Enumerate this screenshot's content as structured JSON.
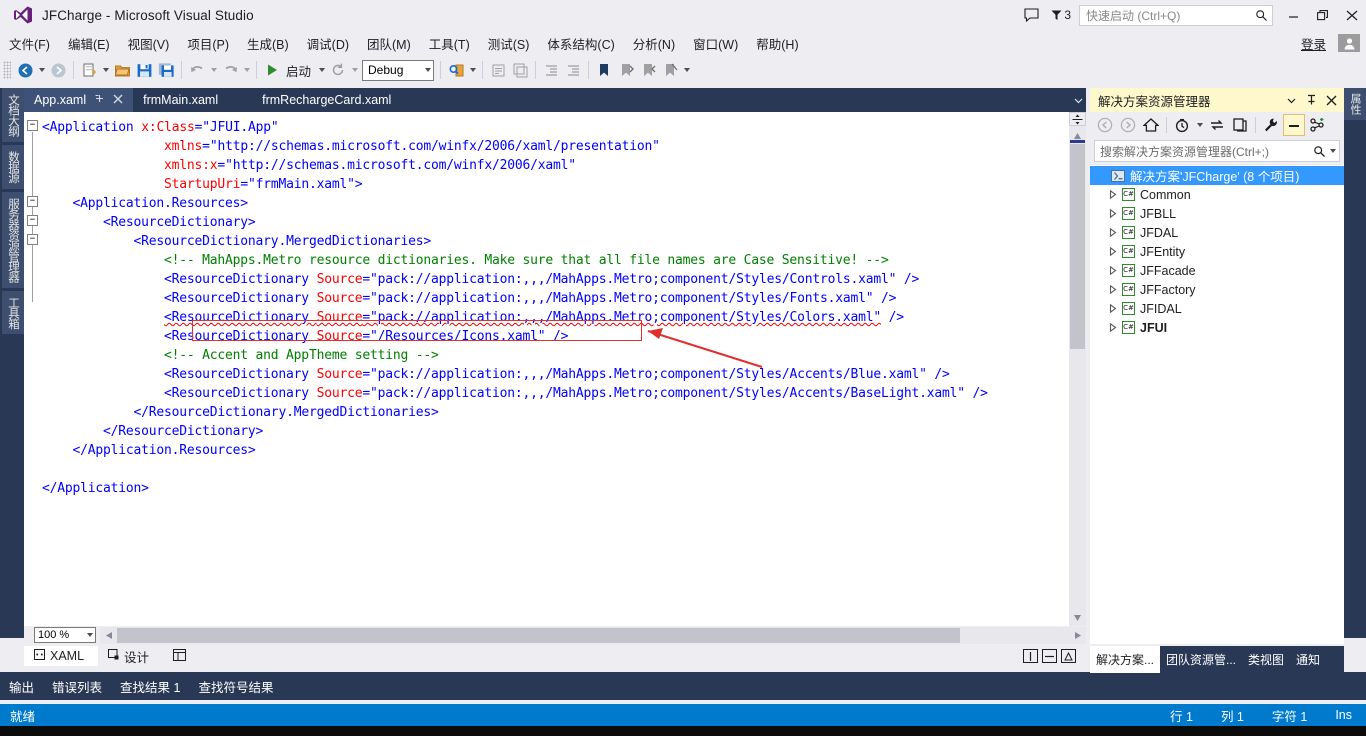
{
  "window": {
    "title": "JFCharge - Microsoft Visual Studio",
    "logo_icon": "visual-studio-logo",
    "feedback_icon": "feedback-smiley-icon",
    "notification_icon": "notification-flag-icon",
    "notification_count": "3",
    "minimize_icon": "minimize-icon",
    "restore_icon": "restore-icon",
    "close_icon": "close-icon"
  },
  "quick_launch": {
    "placeholder": "快速启动 (Ctrl+Q)",
    "value": "",
    "search_icon": "search-icon"
  },
  "menubar": {
    "items": [
      {
        "label": "文件(F)"
      },
      {
        "label": "编辑(E)"
      },
      {
        "label": "视图(V)"
      },
      {
        "label": "项目(P)"
      },
      {
        "label": "生成(B)"
      },
      {
        "label": "调试(D)"
      },
      {
        "label": "团队(M)"
      },
      {
        "label": "工具(T)"
      },
      {
        "label": "测试(S)"
      },
      {
        "label": "体系结构(C)"
      },
      {
        "label": "分析(N)"
      },
      {
        "label": "窗口(W)"
      },
      {
        "label": "帮助(H)"
      }
    ],
    "signin_label": "登录",
    "avatar_icon": "user-avatar-icon"
  },
  "toolbar": {
    "navigate_back_icon": "navigate-back-icon",
    "navigate_forward_icon": "navigate-forward-icon",
    "new_project_icon": "new-project-icon",
    "open_file_icon": "open-file-icon",
    "save_icon": "save-icon",
    "save_all_icon": "save-all-icon",
    "undo_icon": "undo-icon",
    "redo_icon": "redo-icon",
    "start_icon": "start-debug-icon",
    "start_label": "启动",
    "restart_icon": "restart-icon",
    "config_value": "Debug",
    "find_icon": "find-in-files-icon",
    "comment_icon": "comment-selection-icon",
    "uncomment_icon": "uncomment-selection-icon",
    "outdent_icon": "outdent-icon",
    "indent_icon": "indent-icon",
    "bookmark_icon": "bookmark-icon",
    "prev_bookmark_icon": "previous-bookmark-icon",
    "next_bookmark_icon": "next-bookmark-icon",
    "clear_bookmarks_icon": "clear-bookmarks-icon",
    "overflow_icon": "toolbar-overflow-icon"
  },
  "left_vertical_tabs": [
    {
      "label": "文档大纲"
    },
    {
      "label": "数据源"
    },
    {
      "label": "服务器资源管理器"
    },
    {
      "label": "工具箱"
    }
  ],
  "right_vertical_tabs": [
    {
      "label": "属性"
    }
  ],
  "editor_tabs": {
    "items": [
      {
        "label": "App.xaml",
        "active": true,
        "pin_icon": "pin-icon",
        "close_icon": "close-tab-icon"
      },
      {
        "label": "frmMain.xaml",
        "active": false
      },
      {
        "label": "frmRechargeCard.xaml",
        "active": false
      }
    ],
    "dropdown_icon": "tab-list-dropdown-icon"
  },
  "code": {
    "lines": [
      {
        "indent": 0,
        "fold": "minus",
        "segments": [
          {
            "t": "<",
            "c": "k-el"
          },
          {
            "t": "Application",
            "c": "k-el"
          },
          {
            "t": " ",
            "c": ""
          },
          {
            "t": "x:Class",
            "c": "k-attr"
          },
          {
            "t": "=",
            "c": "k-pun"
          },
          {
            "t": "\"JFUI.App\"",
            "c": "k-val"
          }
        ]
      },
      {
        "indent": 0,
        "segments": [
          {
            "t": "                ",
            "c": ""
          },
          {
            "t": "xmlns",
            "c": "k-attr"
          },
          {
            "t": "=",
            "c": "k-pun"
          },
          {
            "t": "\"http://schemas.microsoft.com/winfx/2006/xaml/presentation\"",
            "c": "k-val"
          }
        ]
      },
      {
        "indent": 0,
        "segments": [
          {
            "t": "                ",
            "c": ""
          },
          {
            "t": "xmlns:x",
            "c": "k-attr"
          },
          {
            "t": "=",
            "c": "k-pun"
          },
          {
            "t": "\"http://schemas.microsoft.com/winfx/2006/xaml\"",
            "c": "k-val"
          }
        ]
      },
      {
        "indent": 0,
        "segments": [
          {
            "t": "                ",
            "c": ""
          },
          {
            "t": "StartupUri",
            "c": "k-attr"
          },
          {
            "t": "=",
            "c": "k-pun"
          },
          {
            "t": "\"frmMain.xaml\">",
            "c": "k-val"
          }
        ]
      },
      {
        "indent": 0,
        "fold": "minus",
        "segments": [
          {
            "t": "    ",
            "c": ""
          },
          {
            "t": "<Application.Resources>",
            "c": "k-el"
          }
        ]
      },
      {
        "indent": 0,
        "fold": "minus",
        "segments": [
          {
            "t": "        ",
            "c": ""
          },
          {
            "t": "<ResourceDictionary>",
            "c": "k-el"
          }
        ]
      },
      {
        "indent": 0,
        "fold": "minus",
        "segments": [
          {
            "t": "            ",
            "c": ""
          },
          {
            "t": "<ResourceDictionary.MergedDictionaries>",
            "c": "k-el"
          }
        ]
      },
      {
        "indent": 0,
        "segments": [
          {
            "t": "                ",
            "c": ""
          },
          {
            "t": "<!-- MahApps.Metro resource dictionaries. Make sure that all file names are Case Sensitive! -->",
            "c": "k-cmt"
          }
        ]
      },
      {
        "indent": 0,
        "segments": [
          {
            "t": "                ",
            "c": ""
          },
          {
            "t": "<ResourceDictionary ",
            "c": "k-el"
          },
          {
            "t": "Source",
            "c": "k-attr"
          },
          {
            "t": "=",
            "c": "k-pun"
          },
          {
            "t": "\"pack://application:,,,/MahApps.Metro;component/Styles/Controls.xaml\"",
            "c": "k-val"
          },
          {
            "t": " />",
            "c": "k-el"
          }
        ]
      },
      {
        "indent": 0,
        "segments": [
          {
            "t": "                ",
            "c": ""
          },
          {
            "t": "<ResourceDictionary ",
            "c": "k-el"
          },
          {
            "t": "Source",
            "c": "k-attr"
          },
          {
            "t": "=",
            "c": "k-pun"
          },
          {
            "t": "\"pack://application:,,,/MahApps.Metro;component/Styles/Fonts.xaml\"",
            "c": "k-val"
          },
          {
            "t": " />",
            "c": "k-el"
          }
        ]
      },
      {
        "indent": 0,
        "segments": [
          {
            "t": "                ",
            "c": ""
          },
          {
            "t": "<ResourceDictionary ",
            "c": "k-el squig"
          },
          {
            "t": "Source",
            "c": "k-attr squig"
          },
          {
            "t": "=",
            "c": "k-pun squig"
          },
          {
            "t": "\"pack://application:,,,/MahApps.Metro;component/Styles/Colors.xaml\"",
            "c": "k-val squig"
          },
          {
            "t": " />",
            "c": "k-el"
          }
        ]
      },
      {
        "indent": 0,
        "segments": [
          {
            "t": "                ",
            "c": ""
          },
          {
            "t": "<ResourceDictionary ",
            "c": "k-el"
          },
          {
            "t": "Source",
            "c": "k-attr"
          },
          {
            "t": "=",
            "c": "k-pun"
          },
          {
            "t": "\"/Resources/Icons.xaml\"",
            "c": "k-val"
          },
          {
            "t": " />",
            "c": "k-el"
          }
        ]
      },
      {
        "indent": 0,
        "segments": [
          {
            "t": "                ",
            "c": ""
          },
          {
            "t": "<!-- Accent and AppTheme setting -->",
            "c": "k-cmt"
          }
        ]
      },
      {
        "indent": 0,
        "segments": [
          {
            "t": "                ",
            "c": ""
          },
          {
            "t": "<ResourceDictionary ",
            "c": "k-el"
          },
          {
            "t": "Source",
            "c": "k-attr"
          },
          {
            "t": "=",
            "c": "k-pun"
          },
          {
            "t": "\"pack://application:,,,/MahApps.Metro;component/Styles/Accents/Blue.xaml\"",
            "c": "k-val"
          },
          {
            "t": " />",
            "c": "k-el"
          }
        ]
      },
      {
        "indent": 0,
        "segments": [
          {
            "t": "                ",
            "c": ""
          },
          {
            "t": "<ResourceDictionary ",
            "c": "k-el"
          },
          {
            "t": "Source",
            "c": "k-attr"
          },
          {
            "t": "=",
            "c": "k-pun"
          },
          {
            "t": "\"pack://application:,,,/MahApps.Metro;component/Styles/Accents/BaseLight.xaml\"",
            "c": "k-val"
          },
          {
            "t": " />",
            "c": "k-el"
          }
        ]
      },
      {
        "indent": 0,
        "segments": [
          {
            "t": "            ",
            "c": ""
          },
          {
            "t": "</ResourceDictionary.MergedDictionaries>",
            "c": "k-el"
          }
        ]
      },
      {
        "indent": 0,
        "segments": [
          {
            "t": "        ",
            "c": ""
          },
          {
            "t": "</ResourceDictionary>",
            "c": "k-el"
          }
        ]
      },
      {
        "indent": 0,
        "segments": [
          {
            "t": "    ",
            "c": ""
          },
          {
            "t": "</Application.Resources>",
            "c": "k-el"
          }
        ]
      },
      {
        "indent": 0,
        "segments": [
          {
            "t": "",
            "c": ""
          }
        ]
      },
      {
        "indent": 0,
        "segments": [
          {
            "t": "</Application>",
            "c": "k-el"
          }
        ]
      }
    ],
    "annotation": {
      "highlight_target": "<ResourceDictionary Source=\"/Resources/Icons.xaml\" />",
      "arrow_color": "#E03030",
      "box_color": "#E03030"
    }
  },
  "editor_footer": {
    "zoom_level": "100 %",
    "scroll_left_icon": "scroll-left-icon",
    "scroll_right_icon": "scroll-right-icon"
  },
  "designer_tabs": {
    "items": [
      {
        "label": "XAML",
        "icon": "xaml-view-icon",
        "active": true
      },
      {
        "label": "设计",
        "icon": "design-view-icon",
        "active": false
      }
    ],
    "swap_panes_icon": "swap-panes-icon",
    "split_vertical_icon": "split-vertical-icon",
    "split_horizontal_icon": "split-horizontal-icon",
    "expand_pane_icon": "expand-pane-icon"
  },
  "dock_tabs": {
    "items": [
      {
        "label": "输出"
      },
      {
        "label": "错误列表"
      },
      {
        "label": "查找结果 1"
      },
      {
        "label": "查找符号结果"
      }
    ]
  },
  "solution_explorer": {
    "title": "解决方案资源管理器",
    "dropdown_icon": "chevron-down-icon",
    "pin_icon": "pin-icon",
    "close_icon": "close-icon",
    "toolbar": {
      "back_icon": "navigate-back-icon",
      "forward_icon": "navigate-forward-icon",
      "home_icon": "home-icon",
      "pending_changes_icon": "pending-changes-filter-icon",
      "sync_icon": "sync-with-active-document-icon",
      "refresh_icon": "refresh-icon",
      "properties_icon": "properties-wrench-icon",
      "collapse_all_icon": "collapse-all-icon",
      "show_all_files_icon": "show-all-files-icon"
    },
    "search": {
      "placeholder": "搜索解决方案资源管理器(Ctrl+;)",
      "value": "",
      "search_icon": "search-icon",
      "dropdown_icon": "chevron-down-icon"
    },
    "tree": [
      {
        "label": "解决方案'JFCharge' (8 个项目)",
        "icon": "solution-icon",
        "selected": true,
        "bold": false,
        "depth": 0,
        "expandable": false
      },
      {
        "label": "Common",
        "icon": "csharp-project-icon",
        "selected": false,
        "bold": false,
        "depth": 1,
        "expandable": true
      },
      {
        "label": "JFBLL",
        "icon": "csharp-project-icon",
        "selected": false,
        "bold": false,
        "depth": 1,
        "expandable": true
      },
      {
        "label": "JFDAL",
        "icon": "csharp-project-icon",
        "selected": false,
        "bold": false,
        "depth": 1,
        "expandable": true
      },
      {
        "label": "JFEntity",
        "icon": "csharp-project-icon",
        "selected": false,
        "bold": false,
        "depth": 1,
        "expandable": true
      },
      {
        "label": "JFFacade",
        "icon": "csharp-project-icon",
        "selected": false,
        "bold": false,
        "depth": 1,
        "expandable": true
      },
      {
        "label": "JFFactory",
        "icon": "csharp-project-icon",
        "selected": false,
        "bold": false,
        "depth": 1,
        "expandable": true
      },
      {
        "label": "JFIDAL",
        "icon": "csharp-project-icon",
        "selected": false,
        "bold": false,
        "depth": 1,
        "expandable": true
      },
      {
        "label": "JFUI",
        "icon": "csharp-project-icon",
        "selected": false,
        "bold": true,
        "depth": 1,
        "expandable": true
      }
    ],
    "bottom_tabs": [
      {
        "label": "解决方案...",
        "active": true
      },
      {
        "label": "团队资源管...",
        "active": false
      },
      {
        "label": "类视图",
        "active": false
      },
      {
        "label": "通知",
        "active": false
      }
    ]
  },
  "statusbar": {
    "state": "就绪",
    "line_label": "行 1",
    "col_label": "列 1",
    "char_label": "字符 1",
    "insert_mode": "Ins"
  },
  "colors": {
    "accent": "#007ACC",
    "chrome": "#EEEEF2",
    "dark_panel": "#293955",
    "selection": "#3399FF",
    "header_yellow": "#FFF8CC",
    "annotation_red": "#E03030"
  }
}
